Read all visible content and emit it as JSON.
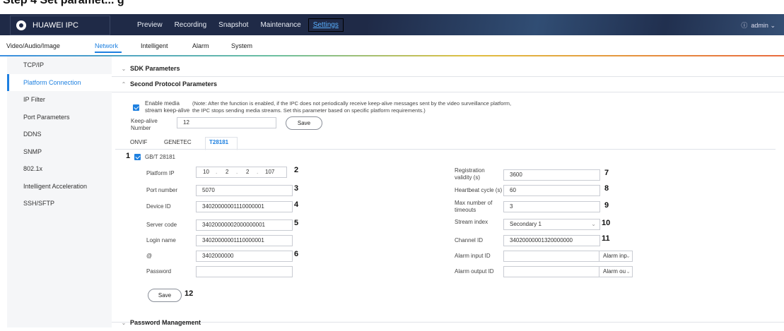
{
  "caption": "Step 4 Set paramet... g",
  "topbar": {
    "brand": "HUAWEI IPC",
    "nav": [
      "Preview",
      "Recording",
      "Snapshot",
      "Maintenance",
      "Settings"
    ],
    "active_nav": "Settings",
    "user": "admin"
  },
  "subnav": {
    "items": [
      "Video/Audio/Image",
      "Network",
      "Intelligent",
      "Alarm",
      "System"
    ],
    "active": "Network"
  },
  "sidebar": {
    "items": [
      "TCP/IP",
      "Platform Connection",
      "IP Filter",
      "Port Parameters",
      "DDNS",
      "SNMP",
      "802.1x",
      "Intelligent Acceleration",
      "SSH/SFTP"
    ],
    "active": "Platform Connection"
  },
  "sections": {
    "sdk": "SDK Parameters",
    "second": "Second Protocol Parameters",
    "password": "Password Management"
  },
  "keepalive": {
    "checkbox_label_line1": "Enable media",
    "checkbox_label_line2": "stream keep-alive",
    "note_line1": "(Note: After the function is enabled, if the IPC does not periodically receive keep-alive messages sent by the video surveillance platform,",
    "note_line2": "the IPC stops sending media streams. Set this parameter based on specific platform requirements.)",
    "number_label_line1": "Keep-alive",
    "number_label_line2": "Number",
    "number_value": "12",
    "save": "Save"
  },
  "tabs": [
    "ONVIF",
    "GENETEC",
    "T28181"
  ],
  "active_tab": "T28181",
  "gb": {
    "enable_label": "GB/T 28181",
    "left": {
      "platform_ip_label": "Platform IP",
      "platform_ip": [
        "10",
        "2",
        "2",
        "107"
      ],
      "port_label": "Port number",
      "port": "5070",
      "device_id_label": "Device ID",
      "device_id": "34020000001110000001",
      "server_code_label": "Server code",
      "server_code": "34020000002000000001",
      "login_label": "Login name",
      "login": "34020000001110000001",
      "at_label": "@",
      "at_value": "3402000000",
      "password_label": "Password",
      "password": ""
    },
    "right": {
      "reg_label_line1": "Registration",
      "reg_label_line2": "validity (s)",
      "reg_value": "3600",
      "heartbeat_label": "Heartbeat cycle (s)",
      "heartbeat": "60",
      "timeouts_label_line1": "Max number of",
      "timeouts_label_line2": "timeouts",
      "timeouts": "3",
      "stream_label": "Stream index",
      "stream": "Secondary 1",
      "channel_label": "Channel ID",
      "channel": "34020000001320000000",
      "alarm_in_label": "Alarm input ID",
      "alarm_in": "",
      "alarm_in_select": "Alarm inp",
      "alarm_out_label": "Alarm output ID",
      "alarm_out": "",
      "alarm_out_select": "Alarm ou"
    },
    "save": "Save"
  },
  "callouts": [
    "1",
    "2",
    "3",
    "4",
    "5",
    "6",
    "7",
    "8",
    "9",
    "10",
    "11",
    "12"
  ],
  "colors": {
    "accent": "#1e80e0",
    "topbar": "#1f2a47",
    "sidebar": "#f5f6f8"
  }
}
